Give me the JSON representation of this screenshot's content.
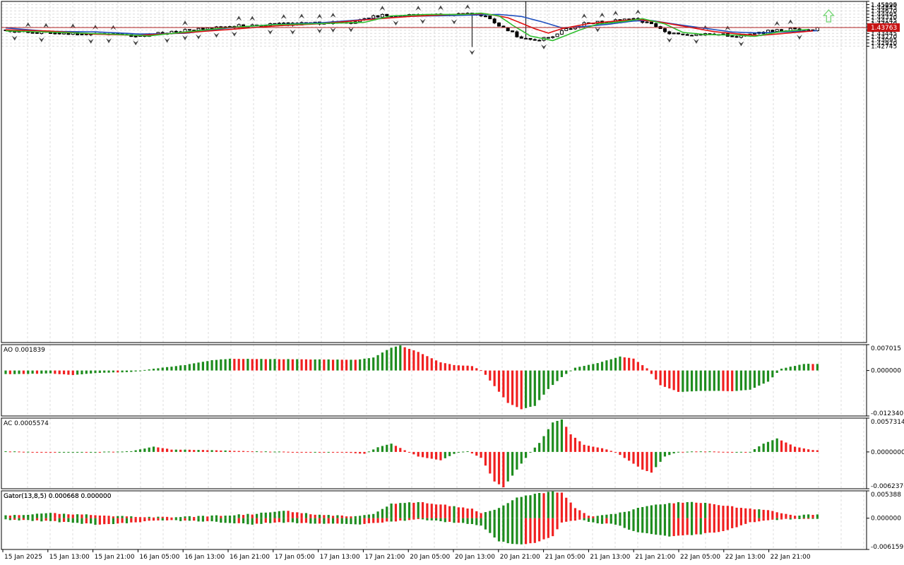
{
  "colors": {
    "background": "#ffffff",
    "grid": "#dcdcdc",
    "frame": "#000000",
    "bull_candle": "#ffffff",
    "bear_candle": "#000000",
    "alligator_jaw": "#1f4fbf",
    "alligator_teeth": "#e01010",
    "alligator_lips": "#2fbf2f",
    "histogram_up": "#1e8c1e",
    "histogram_down": "#f02020",
    "current_price_line": "#b02020",
    "current_price_label_bg": "#c81414",
    "buy_arrow": "#7ad67a"
  },
  "icons": {
    "fractal_up": "fractal-up-arrow-icon",
    "fractal_down": "fractal-down-arrow-icon",
    "buy_signal": "buy-signal-up-arrow-icon"
  },
  "chart_data": [
    {
      "panel": "price",
      "type": "candlestick",
      "title": "",
      "current_price": 1.43763,
      "current_price_label": "1.43763",
      "ylim": [
        1.2657,
        1.4519
      ],
      "y_ticks": [
        "1.45195",
        "1.45020",
        "1.44845",
        "1.44670",
        "1.44495",
        "1.44320",
        "1.44145",
        "1.43970",
        "1.43795",
        "1.43620",
        "1.43445",
        "1.43270",
        "1.43095",
        "1.42920",
        "1.42745"
      ],
      "x_ticks": [
        "15 Jan 2025",
        "15 Jan 13:00",
        "15 Jan 21:00",
        "16 Jan 05:00",
        "16 Jan 13:00",
        "16 Jan 21:00",
        "17 Jan 05:00",
        "17 Jan 13:00",
        "17 Jan 21:00",
        "20 Jan 05:00",
        "20 Jan 13:00",
        "20 Jan 21:00",
        "21 Jan 05:00",
        "21 Jan 13:00",
        "21 Jan 21:00",
        "22 Jan 05:00",
        "22 Jan 13:00",
        "22 Jan 21:00"
      ],
      "series": [
        {
          "name": "Jaw",
          "indicator": "Alligator",
          "anchors": [
            [
              0,
              1.4374
            ],
            [
              10,
              1.4355
            ],
            [
              20,
              1.4353
            ],
            [
              30,
              1.4341
            ],
            [
              40,
              1.4345
            ],
            [
              50,
              1.4375
            ],
            [
              60,
              1.4393
            ],
            [
              70,
              1.4402
            ],
            [
              80,
              1.442
            ],
            [
              90,
              1.4438
            ],
            [
              100,
              1.4442
            ],
            [
              110,
              1.4448
            ],
            [
              115,
              1.4437
            ],
            [
              120,
              1.4405
            ],
            [
              124,
              1.4375
            ],
            [
              128,
              1.438
            ],
            [
              134,
              1.4393
            ],
            [
              140,
              1.4412
            ],
            [
              144,
              1.4415
            ],
            [
              150,
              1.4392
            ],
            [
              156,
              1.4372
            ],
            [
              162,
              1.4352
            ],
            [
              168,
              1.4347
            ],
            [
              174,
              1.4353
            ],
            [
              181,
              1.4359
            ]
          ]
        },
        {
          "name": "Teeth",
          "indicator": "Alligator",
          "anchors": [
            [
              0,
              1.4364
            ],
            [
              10,
              1.4357
            ],
            [
              20,
              1.434
            ],
            [
              30,
              1.4334
            ],
            [
              40,
              1.4348
            ],
            [
              50,
              1.4366
            ],
            [
              60,
              1.4385
            ],
            [
              70,
              1.4397
            ],
            [
              80,
              1.4418
            ],
            [
              90,
              1.4437
            ],
            [
              100,
              1.4448
            ],
            [
              107,
              1.4452
            ],
            [
              112,
              1.443
            ],
            [
              118,
              1.437
            ],
            [
              121,
              1.4346
            ],
            [
              124,
              1.437
            ],
            [
              130,
              1.4398
            ],
            [
              136,
              1.4412
            ],
            [
              141,
              1.442
            ],
            [
              146,
              1.4406
            ],
            [
              152,
              1.438
            ],
            [
              158,
              1.4354
            ],
            [
              164,
              1.434
            ],
            [
              168,
              1.4333
            ],
            [
              174,
              1.4345
            ],
            [
              180,
              1.4358
            ]
          ]
        },
        {
          "name": "Lips",
          "indicator": "Alligator",
          "anchors": [
            [
              0,
              1.4358
            ],
            [
              12,
              1.435
            ],
            [
              24,
              1.434
            ],
            [
              32,
              1.4331
            ],
            [
              40,
              1.4352
            ],
            [
              50,
              1.4377
            ],
            [
              60,
              1.4392
            ],
            [
              70,
              1.4398
            ],
            [
              80,
              1.4405
            ],
            [
              86,
              1.444
            ],
            [
              94,
              1.4448
            ],
            [
              102,
              1.4448
            ],
            [
              106,
              1.4455
            ],
            [
              110,
              1.444
            ],
            [
              113,
              1.439
            ],
            [
              117,
              1.433
            ],
            [
              122,
              1.4305
            ],
            [
              128,
              1.4363
            ],
            [
              132,
              1.4395
            ],
            [
              138,
              1.441
            ],
            [
              142,
              1.4425
            ],
            [
              147,
              1.4396
            ],
            [
              151,
              1.435
            ],
            [
              156,
              1.4338
            ],
            [
              163,
              1.4335
            ],
            [
              167,
              1.4328
            ],
            [
              173,
              1.4355
            ],
            [
              179,
              1.4366
            ]
          ]
        }
      ]
    },
    {
      "panel": "ao",
      "type": "bar",
      "title": "AO 0.001839",
      "ylim": [
        -0.01234,
        0.007015
      ],
      "y_ticks": [
        "0.007015",
        "0.000000",
        "-0.012340"
      ],
      "anchors": [
        [
          0,
          -0.001
        ],
        [
          10,
          -0.0008
        ],
        [
          15,
          -0.0012
        ],
        [
          20,
          -0.0007
        ],
        [
          28,
          -0.0004
        ],
        [
          33,
          0.0005
        ],
        [
          40,
          0.0015
        ],
        [
          46,
          0.0028
        ],
        [
          50,
          0.0032
        ],
        [
          60,
          0.0031
        ],
        [
          70,
          0.003
        ],
        [
          78,
          0.0029
        ],
        [
          82,
          0.0035
        ],
        [
          86,
          0.0062
        ],
        [
          88,
          0.0068
        ],
        [
          92,
          0.005
        ],
        [
          97,
          0.0022
        ],
        [
          100,
          0.0015
        ],
        [
          104,
          0.0012
        ],
        [
          106,
          0.0001
        ],
        [
          107,
          -0.0012
        ],
        [
          112,
          -0.0088
        ],
        [
          115,
          -0.0105
        ],
        [
          118,
          -0.0096
        ],
        [
          121,
          -0.005
        ],
        [
          124,
          -0.0018
        ],
        [
          127,
          0.0008
        ],
        [
          132,
          0.002
        ],
        [
          137,
          0.0038
        ],
        [
          140,
          0.0032
        ],
        [
          143,
          0.0006
        ],
        [
          146,
          -0.004
        ],
        [
          150,
          -0.0058
        ],
        [
          156,
          -0.0055
        ],
        [
          162,
          -0.0056
        ],
        [
          166,
          -0.0052
        ],
        [
          170,
          -0.003
        ],
        [
          173,
          0.0005
        ],
        [
          178,
          0.0018
        ],
        [
          181,
          0.0018
        ]
      ]
    },
    {
      "panel": "ac",
      "type": "bar",
      "title": "AC 0.0005574",
      "ylim": [
        -0.006237,
        0.0057314
      ],
      "y_ticks": [
        "0.0057314",
        "0.0000000",
        "-0.0062370"
      ],
      "anchors": [
        [
          0,
          0.0001
        ],
        [
          12,
          -0.0001
        ],
        [
          20,
          0.0
        ],
        [
          28,
          0.0001
        ],
        [
          33,
          0.0009
        ],
        [
          37,
          0.0004
        ],
        [
          45,
          0.0003
        ],
        [
          55,
          0.0001
        ],
        [
          65,
          0.0
        ],
        [
          75,
          -0.0001
        ],
        [
          80,
          -0.0003
        ],
        [
          83,
          0.0008
        ],
        [
          86,
          0.0014
        ],
        [
          89,
          0.0003
        ],
        [
          92,
          -0.0008
        ],
        [
          97,
          -0.0014
        ],
        [
          101,
          0.0
        ],
        [
          103,
          0.0001
        ],
        [
          106,
          -0.001
        ],
        [
          109,
          -0.005
        ],
        [
          111,
          -0.006
        ],
        [
          114,
          -0.003
        ],
        [
          117,
          0.0
        ],
        [
          119,
          0.0015
        ],
        [
          122,
          0.005
        ],
        [
          124,
          0.0055
        ],
        [
          126,
          0.003
        ],
        [
          129,
          0.0012
        ],
        [
          133,
          0.0006
        ],
        [
          136,
          0.0
        ],
        [
          138,
          -0.001
        ],
        [
          142,
          -0.003
        ],
        [
          144,
          -0.0035
        ],
        [
          147,
          -0.0008
        ],
        [
          150,
          0.0
        ],
        [
          155,
          0.0001
        ],
        [
          162,
          0.0
        ],
        [
          166,
          0.0
        ],
        [
          169,
          0.0014
        ],
        [
          172,
          0.0023
        ],
        [
          176,
          0.0009
        ],
        [
          180,
          0.0003
        ]
      ]
    },
    {
      "panel": "gator",
      "type": "bar",
      "title": "Gator(13,8,5) 0.000668 0.000000",
      "ylim": [
        -0.006159,
        0.005388
      ],
      "y_ticks": [
        "0.005388",
        "0.000000",
        "-0.006159"
      ],
      "upper_anchors": [
        [
          0,
          0.0005
        ],
        [
          10,
          0.001
        ],
        [
          20,
          0.0006
        ],
        [
          28,
          0.0003
        ],
        [
          35,
          0.0002
        ],
        [
          45,
          0.0004
        ],
        [
          55,
          0.0008
        ],
        [
          62,
          0.0015
        ],
        [
          70,
          0.0006
        ],
        [
          78,
          0.0004
        ],
        [
          82,
          0.0009
        ],
        [
          86,
          0.0028
        ],
        [
          92,
          0.0032
        ],
        [
          98,
          0.0026
        ],
        [
          104,
          0.0018
        ],
        [
          106,
          0.001
        ],
        [
          110,
          0.002
        ],
        [
          114,
          0.004
        ],
        [
          118,
          0.0048
        ],
        [
          122,
          0.0052
        ],
        [
          124,
          0.005
        ],
        [
          127,
          0.002
        ],
        [
          130,
          0.0004
        ],
        [
          134,
          0.0006
        ],
        [
          138,
          0.0012
        ],
        [
          142,
          0.0022
        ],
        [
          146,
          0.0028
        ],
        [
          152,
          0.0032
        ],
        [
          158,
          0.0028
        ],
        [
          164,
          0.002
        ],
        [
          170,
          0.0015
        ],
        [
          173,
          0.001
        ],
        [
          176,
          0.0005
        ],
        [
          180,
          0.0007
        ]
      ],
      "lower_anchors": [
        [
          0,
          -0.0003
        ],
        [
          10,
          -0.0006
        ],
        [
          20,
          -0.0012
        ],
        [
          26,
          -0.001
        ],
        [
          34,
          -0.0004
        ],
        [
          45,
          -0.0006
        ],
        [
          55,
          -0.0012
        ],
        [
          60,
          -0.0008
        ],
        [
          70,
          -0.001
        ],
        [
          78,
          -0.0013
        ],
        [
          84,
          -0.0008
        ],
        [
          92,
          -0.0002
        ],
        [
          98,
          -0.0007
        ],
        [
          104,
          -0.0011
        ],
        [
          106,
          -0.0015
        ],
        [
          110,
          -0.0045
        ],
        [
          114,
          -0.0052
        ],
        [
          118,
          -0.0048
        ],
        [
          122,
          -0.0035
        ],
        [
          124,
          -0.0008
        ],
        [
          128,
          -0.0003
        ],
        [
          132,
          -0.001
        ],
        [
          136,
          -0.0012
        ],
        [
          140,
          -0.0026
        ],
        [
          144,
          -0.0032
        ],
        [
          148,
          -0.0036
        ],
        [
          154,
          -0.0032
        ],
        [
          160,
          -0.0026
        ],
        [
          166,
          -0.0008
        ],
        [
          170,
          -0.0004
        ],
        [
          174,
          -0.0002
        ],
        [
          180,
          0.0
        ]
      ]
    }
  ]
}
